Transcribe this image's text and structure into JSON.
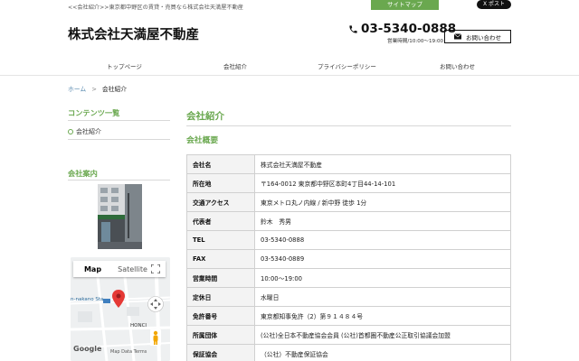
{
  "header": {
    "tagline": "<<会社紹介>>東京都中野区の賃貸・売買なら株式会社天満屋不動産",
    "sitemap_label": "サイトマップ",
    "xpost_label": "X ポスト",
    "company_name": "株式会社天満屋不動産",
    "phone": "03-5340-0888",
    "hours": "営業時間/10:00～19:00",
    "contact_label": "お問い合わせ"
  },
  "nav": {
    "items": [
      {
        "label": "トップページ"
      },
      {
        "label": "会社紹介"
      },
      {
        "label": "プライバシーポリシー"
      },
      {
        "label": "お問い合わせ"
      }
    ]
  },
  "breadcrumb": {
    "home": "ホーム",
    "separator": ">",
    "current": "会社紹介"
  },
  "sidebar": {
    "contents_heading": "コンテンツ一覧",
    "contents_item": "会社紹介",
    "company_heading": "会社案内",
    "map": {
      "map_label": "Map",
      "satellite_label": "Satellite",
      "station_label": "n-nakano Sta",
      "honci_label": "HONCI",
      "google_label": "Google",
      "footer_text": "Map Data   Terms"
    }
  },
  "main": {
    "title": "会社紹介",
    "subtitle": "会社概要",
    "rows": [
      {
        "label": "会社名",
        "value": "株式会社天満屋不動産"
      },
      {
        "label": "所在地",
        "value": "〒164-0012 東京都中野区本町4丁目44-14-101"
      },
      {
        "label": "交通アクセス",
        "value": "東京メトロ丸ノ内線 / 新中野 徒歩 1分"
      },
      {
        "label": "代表者",
        "value": "鈴木　秀男"
      },
      {
        "label": "TEL",
        "value": "03-5340-0888"
      },
      {
        "label": "FAX",
        "value": "03-5340-0889"
      },
      {
        "label": "営業時間",
        "value": "10:00～19:00"
      },
      {
        "label": "定休日",
        "value": "水曜日"
      },
      {
        "label": "免許番号",
        "value": "東京都知事免許（2）第９１４８４号"
      },
      {
        "label": "所属団体",
        "value": "(公社)全日本不動産協会会員 (公社)首都圏不動産公正取引協議会加盟"
      },
      {
        "label": "保証協会",
        "value": "（公社）不動産保証協会"
      }
    ]
  },
  "colors": {
    "accent": "#6aa84f",
    "link": "#5b8bb0"
  }
}
